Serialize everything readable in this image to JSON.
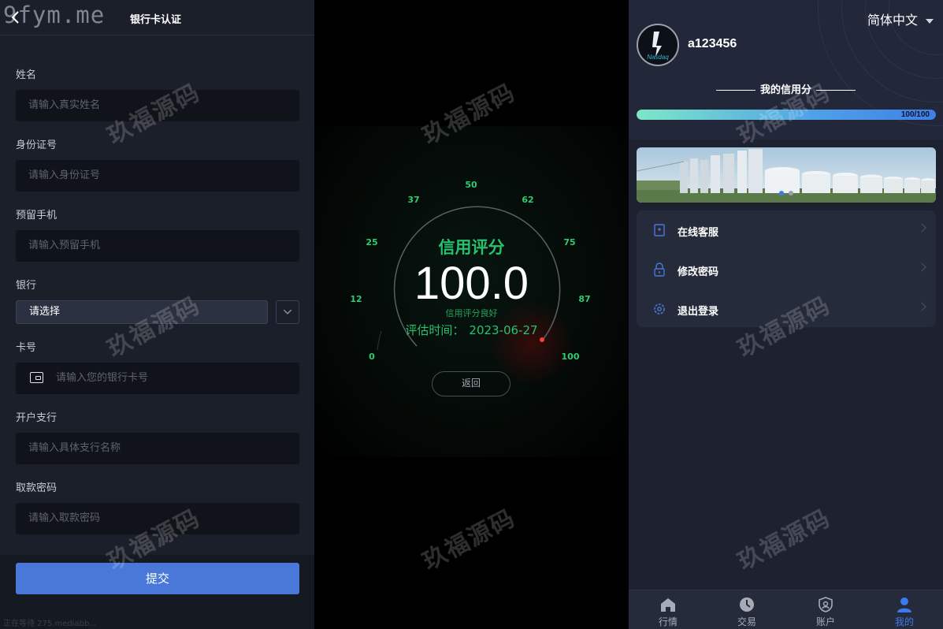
{
  "left": {
    "site_mark": "9fym.me",
    "title": "银行卡认证",
    "fields": {
      "name": {
        "label": "姓名",
        "placeholder": "请输入真实姓名"
      },
      "id": {
        "label": "身份证号",
        "placeholder": "请输入身份证号"
      },
      "phone": {
        "label": "预留手机",
        "placeholder": "请输入预留手机"
      },
      "bank": {
        "label": "银行",
        "value": "请选择"
      },
      "card": {
        "label": "卡号",
        "placeholder": "请输入您的银行卡号"
      },
      "branch": {
        "label": "开户支行",
        "placeholder": "请输入具体支行名称"
      },
      "password": {
        "label": "取款密码",
        "placeholder": "请输入取款密码"
      }
    },
    "submit_label": "提交",
    "footnote": "正在等待 275.mediabb..."
  },
  "gauge": {
    "ticks": [
      "0",
      "12",
      "25",
      "37",
      "50",
      "62",
      "75",
      "87",
      "100"
    ],
    "title": "信用评分",
    "score": "100.0",
    "subtitle": "信用评分良好",
    "time_label": "评估时间：",
    "time_value": "2023-06-27",
    "return_label": "返回"
  },
  "profile": {
    "language": "简体中文",
    "avatar_text": "Nasdaq",
    "username": "a123456",
    "credit_title": "我的信用分",
    "credit_score": "100/100",
    "credit_fraction": 1.0,
    "banner_dots": 2,
    "menu": [
      {
        "label": "在线客服",
        "icon": "customer-service-icon"
      },
      {
        "label": "修改密码",
        "icon": "lock-icon"
      },
      {
        "label": "退出登录",
        "icon": "gear-icon"
      }
    ],
    "tabs": [
      {
        "label": "行情",
        "icon": "home-icon"
      },
      {
        "label": "交易",
        "icon": "clock-icon"
      },
      {
        "label": "账户",
        "icon": "shield-user-icon"
      },
      {
        "label": "我的",
        "icon": "user-icon"
      }
    ]
  },
  "watermark": "玖福源码",
  "colors": {
    "accent_blue": "#4a78d8",
    "gauge_green": "#27c26e",
    "active_tab": "#3b7bf0"
  }
}
